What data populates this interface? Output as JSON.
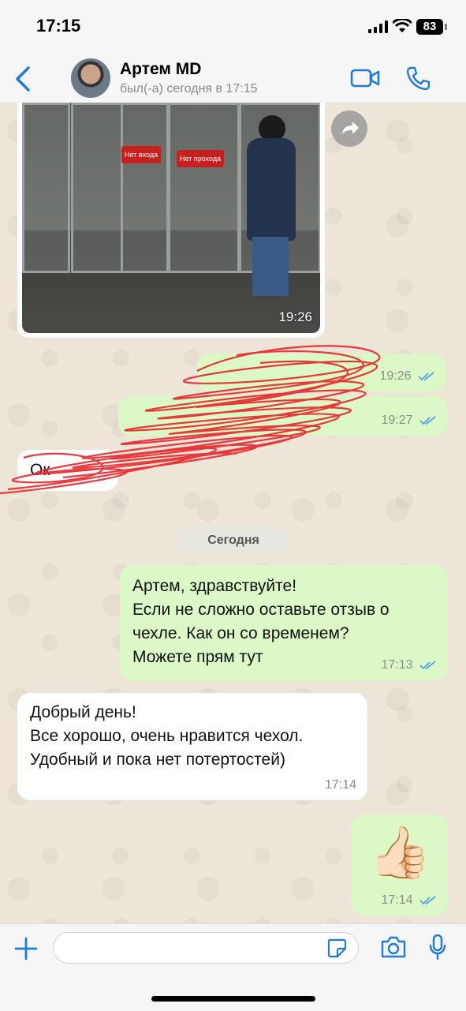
{
  "status_bar": {
    "time": "17:15",
    "battery": "83"
  },
  "header": {
    "contact_name": "Артем MD",
    "contact_status": "был(-а) сегодня в 17:15"
  },
  "messages": {
    "photo": {
      "time": "19:26",
      "sign_1": "Нет входа",
      "sign_2": "Нет прохода"
    },
    "redacted_out_1": {
      "time": "19:26"
    },
    "redacted_out_2": {
      "time": "19:27"
    },
    "redacted_in_1": {
      "text": "Ок"
    },
    "date_divider": "Сегодня",
    "out_request": {
      "lines": [
        "Артем, здравствуйте!",
        "Если не сложно оставьте отзыв о",
        "чехле. Как он со временем?",
        "Можете прям тут"
      ],
      "time": "17:13"
    },
    "in_reply": {
      "lines": [
        "Добрый день!",
        "Все хорошо, очень нравится чехол.",
        "Удобный и пока нет потертостей)"
      ],
      "time": "17:14"
    },
    "out_emoji": {
      "emoji": "👍🏻",
      "time": "17:14"
    }
  },
  "input": {
    "placeholder": ""
  },
  "colors": {
    "accent": "#1f7ae0",
    "outgoing_bubble": "#dcf8c6",
    "incoming_bubble": "#ffffff",
    "read_checks": "#4fa3e8",
    "scribble": "#e8262a"
  }
}
